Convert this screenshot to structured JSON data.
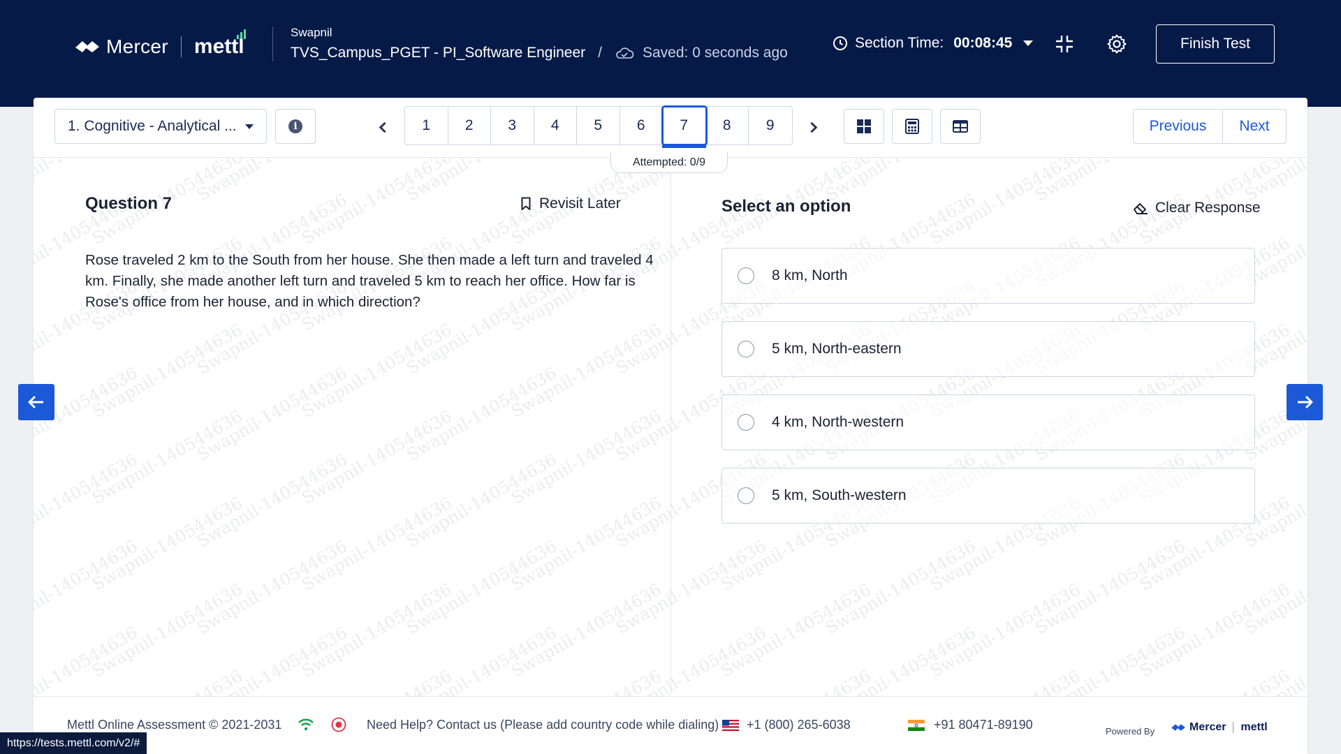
{
  "header": {
    "brand_mercer": "Mercer",
    "brand_mettl": "mettl",
    "candidate_name": "Swapnil",
    "test_title": "TVS_Campus_PGET - PI_Software Engineer",
    "separator": "/",
    "saved_status": "Saved: 0 seconds ago",
    "section_time_label": "Section Time:",
    "section_time_value": "00:08:45",
    "finish_label": "Finish Test"
  },
  "toolbar": {
    "section_selected": "1. Cognitive - Analytical ...",
    "pages": [
      "1",
      "2",
      "3",
      "4",
      "5",
      "6",
      "7",
      "8",
      "9"
    ],
    "active_page": "7",
    "attempted": "Attempted: 0/9",
    "previous_label": "Previous",
    "next_label": "Next"
  },
  "question": {
    "title": "Question 7",
    "revisit_label": "Revisit Later",
    "text": "Rose traveled 2 km to the South from her house. She then made a left turn and traveled 4 km. Finally, she made another left turn and traveled 5 km to reach her office. How far is Rose's office from her house, and in which direction?"
  },
  "options_panel": {
    "title": "Select an option",
    "clear_label": "Clear Response",
    "options": [
      "8 km, North",
      "5 km, North-eastern",
      "4 km, North-western",
      "5 km, South-western"
    ]
  },
  "watermark_text": "Swapnil-140544636",
  "footer": {
    "copyright": "Mettl Online Assessment © 2021-2031",
    "help": "Need Help? Contact us (Please add country code while dialing)",
    "phone_us": "+1 (800) 265-6038",
    "phone_in": "+91 80471-89190",
    "powered_by": "Powered By",
    "brand_mercer": "Mercer",
    "brand_mettl": "mettl"
  },
  "status_url": "https://tests.mettl.com/v2/#",
  "colors": {
    "header_bg": "#061A48",
    "accent": "#1b59d9",
    "mettl_green": "#5ed6a0"
  }
}
